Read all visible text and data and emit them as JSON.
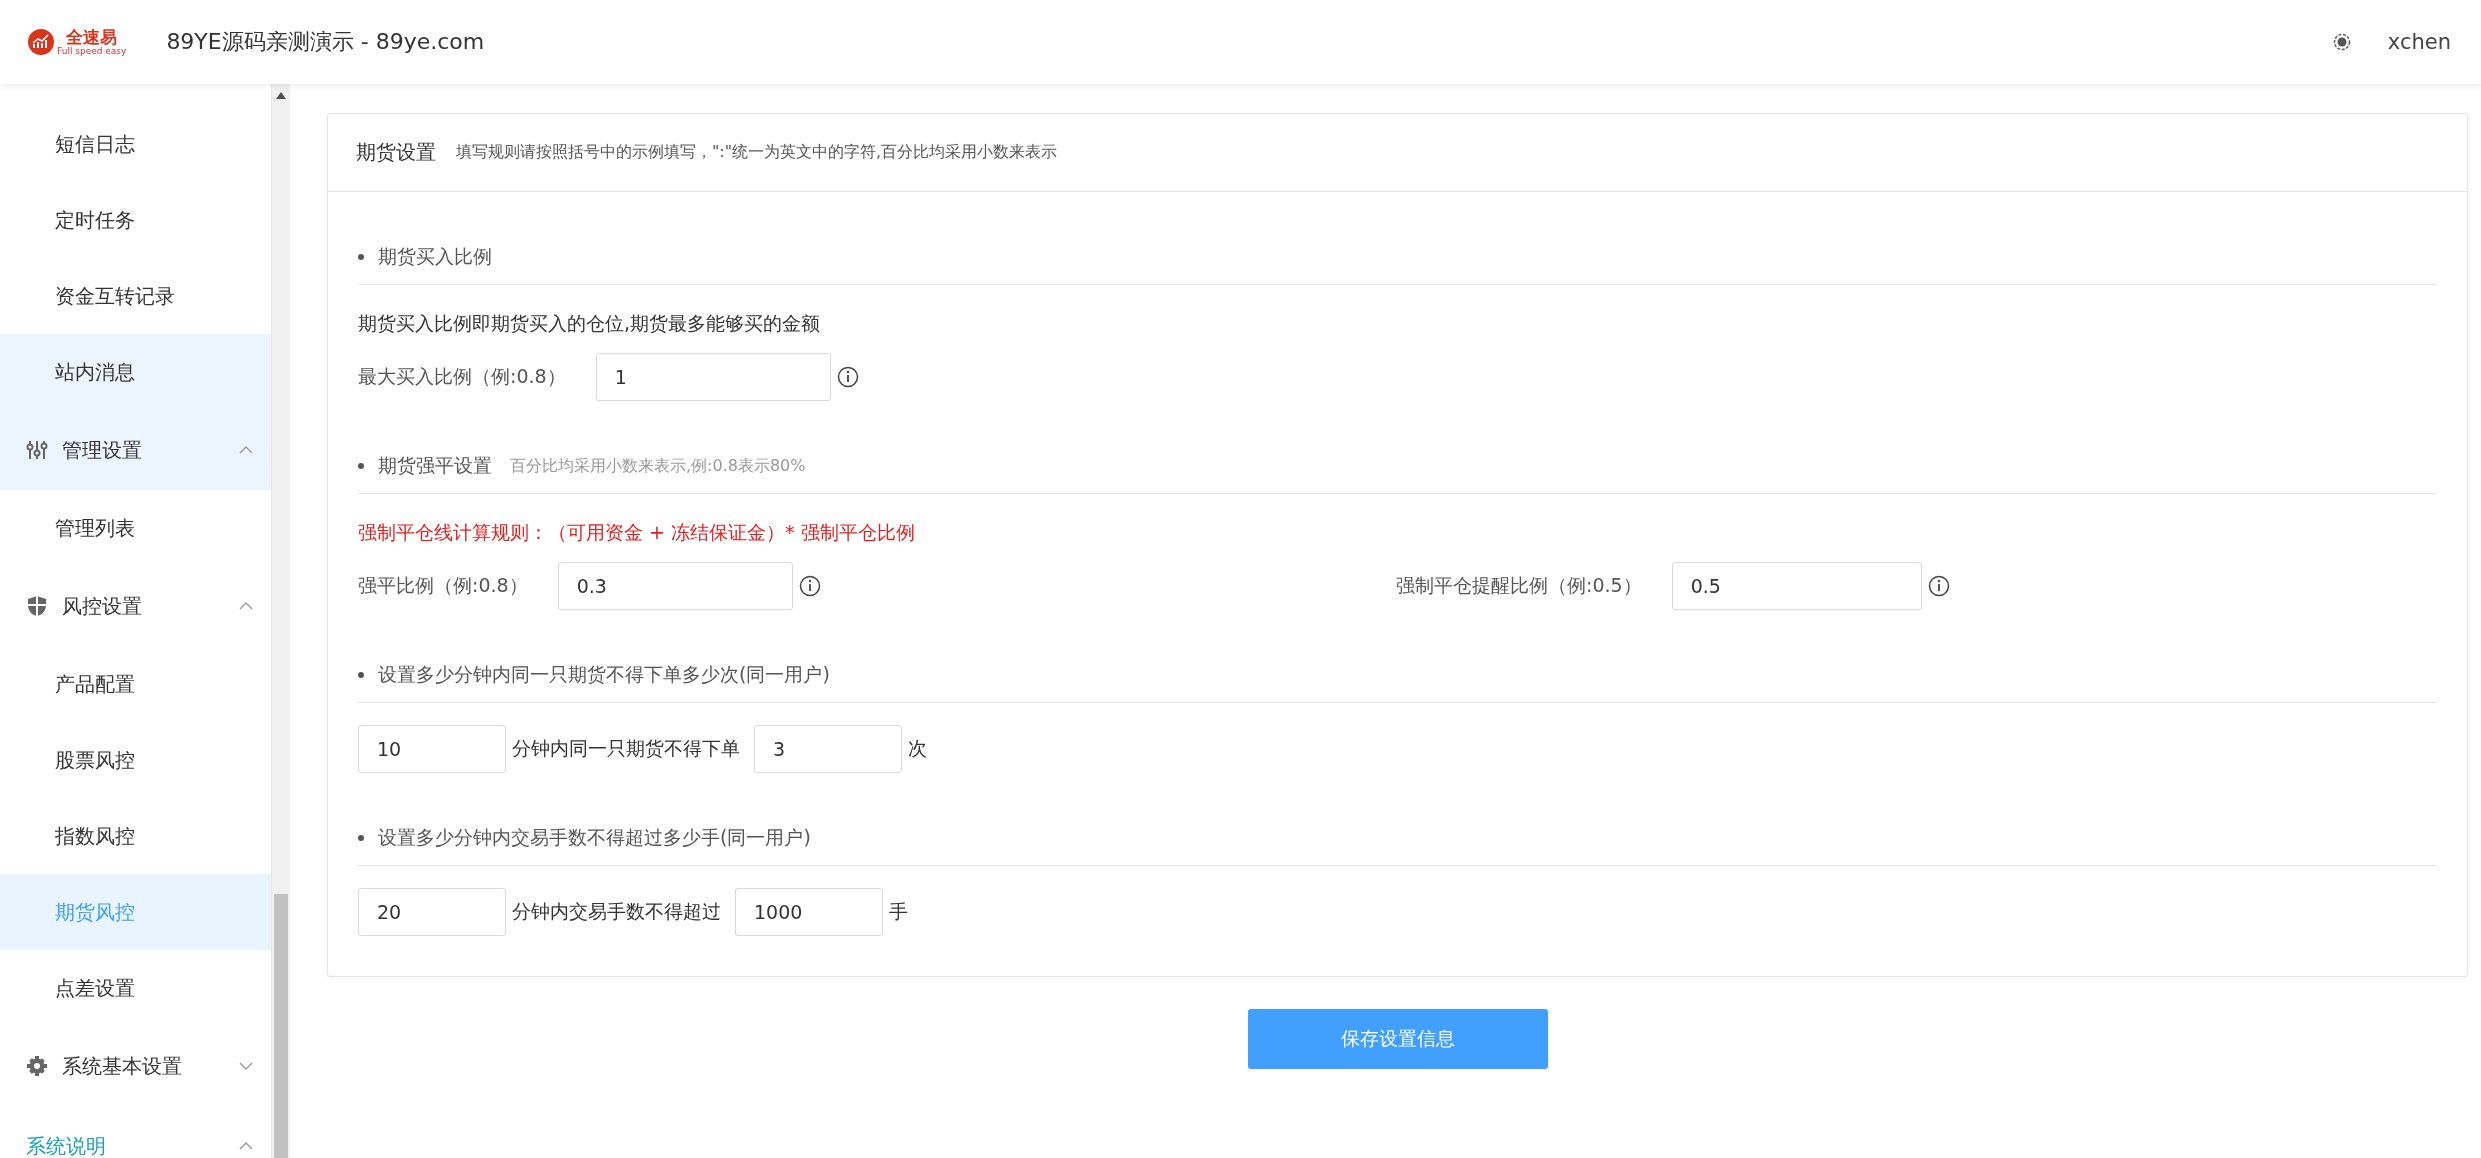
{
  "header": {
    "logo": {
      "name": "全速易",
      "tagline": "Full speed easy"
    },
    "title": "89YE源码亲测演示 - 89ye.com",
    "user": "xchen"
  },
  "sidebar": {
    "items": [
      {
        "kind": "item",
        "label": "短信日志",
        "selected": false,
        "highlighted": false
      },
      {
        "kind": "item",
        "label": "定时任务",
        "selected": false,
        "highlighted": false
      },
      {
        "kind": "item",
        "label": "资金互转记录",
        "selected": false,
        "highlighted": false
      },
      {
        "kind": "item",
        "label": "站内消息",
        "selected": false,
        "highlighted": true
      },
      {
        "kind": "group",
        "label": "管理设置",
        "expanded": true,
        "active": false,
        "highlighted": true,
        "children": [
          {
            "kind": "item",
            "label": "管理列表",
            "selected": false,
            "highlighted": false
          }
        ]
      },
      {
        "kind": "group",
        "label": "风控设置",
        "expanded": true,
        "active": false,
        "highlighted": false,
        "children": [
          {
            "kind": "item",
            "label": "产品配置",
            "selected": false,
            "highlighted": false
          },
          {
            "kind": "item",
            "label": "股票风控",
            "selected": false,
            "highlighted": false
          },
          {
            "kind": "item",
            "label": "指数风控",
            "selected": false,
            "highlighted": false
          },
          {
            "kind": "item",
            "label": "期货风控",
            "selected": true,
            "highlighted": false
          },
          {
            "kind": "item",
            "label": "点差设置",
            "selected": false,
            "highlighted": false
          }
        ]
      },
      {
        "kind": "group",
        "label": "系统基本设置",
        "expanded": false,
        "active": false,
        "highlighted": false
      },
      {
        "kind": "group",
        "label": "系统说明",
        "expanded": true,
        "active": true,
        "highlighted": false
      }
    ]
  },
  "settings": {
    "title": "期货设置",
    "hint": "填写规则请按照括号中的示例填写，\":\"统一为英文中的字符,百分比均采用小数来表示",
    "sections": [
      {
        "title": "期货买入比例",
        "rows": [
          {
            "kind": "description",
            "text": "期货买入比例即期货买入的仓位,期货最多能够买的金额"
          },
          {
            "kind": "fields",
            "fields": [
              {
                "label": "最大买入比例（例:0.8）",
                "value": "1"
              }
            ]
          }
        ]
      },
      {
        "title": "期货强平设置",
        "note": "百分比均采用小数来表示,例:0.8表示80%",
        "rows": [
          {
            "kind": "notice",
            "text": "强制平仓线计算规则：（可用资金 + 冻结保证金）* 强制平仓比例"
          },
          {
            "kind": "fields",
            "fields": [
              {
                "label": "强平比例（例:0.8）",
                "value": "0.3"
              },
              {
                "label": "强制平仓提醒比例（例:0.5）",
                "value": "0.5"
              }
            ]
          }
        ]
      },
      {
        "title": "设置多少分钟内同一只期货不得下单多少次(同一用户)",
        "rows": [
          {
            "kind": "inline",
            "parts": [
              {
                "kind": "input",
                "value": "10"
              },
              {
                "kind": "text",
                "text": "分钟内同一只期货不得下单"
              },
              {
                "kind": "input",
                "value": "3"
              },
              {
                "kind": "text",
                "text": "次"
              }
            ]
          }
        ]
      },
      {
        "title": "设置多少分钟内交易手数不得超过多少手(同一用户)",
        "rows": [
          {
            "kind": "inline",
            "parts": [
              {
                "kind": "input",
                "value": "20"
              },
              {
                "kind": "text",
                "text": "分钟内交易手数不得超过"
              },
              {
                "kind": "input",
                "value": "1000"
              },
              {
                "kind": "text",
                "text": "手"
              }
            ]
          }
        ]
      }
    ]
  },
  "save_button": "保存设置信息"
}
